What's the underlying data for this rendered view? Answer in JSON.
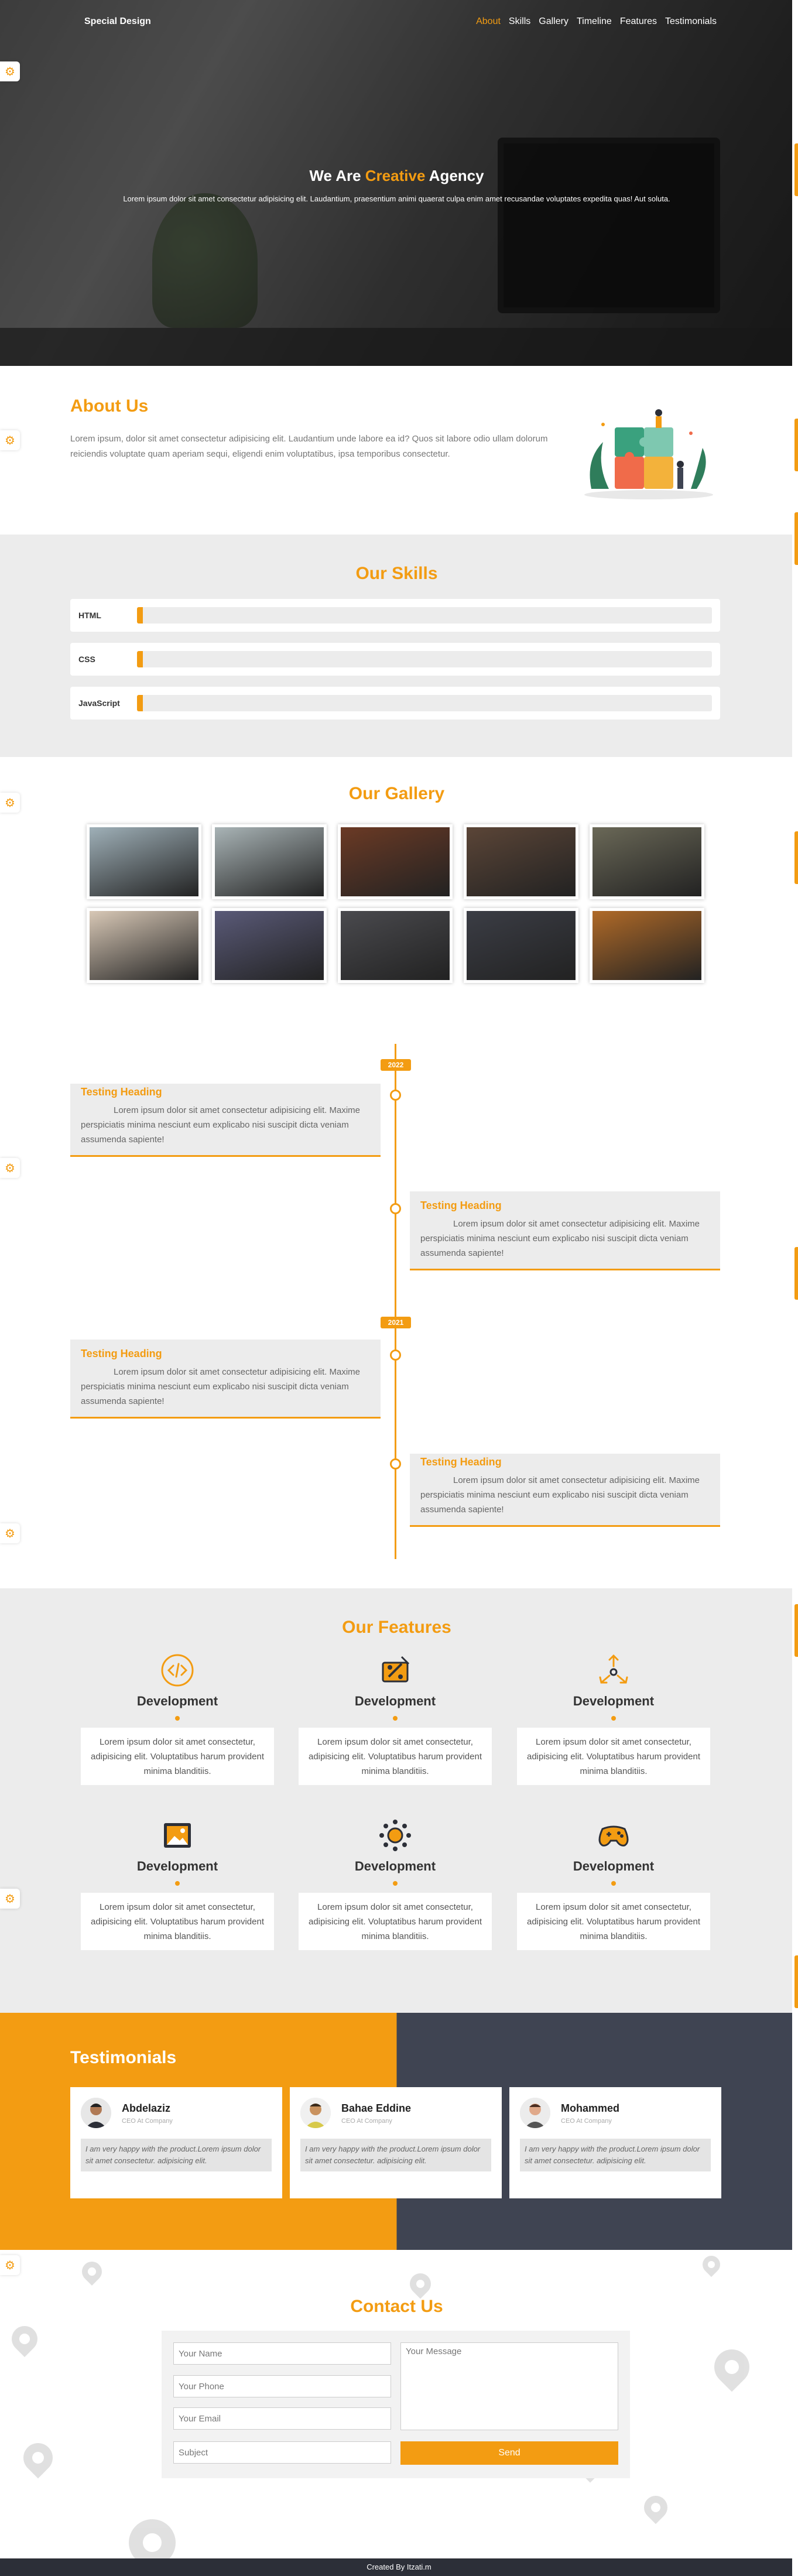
{
  "nav": {
    "logo": "Special Design",
    "links": [
      "About",
      "Skills",
      "Gallery",
      "Timeline",
      "Features",
      "Testimonials"
    ]
  },
  "hero": {
    "title_before": "We Are ",
    "title_accent": "Creative",
    "title_after": " Agency",
    "text": "Lorem ipsum dolor sit amet consectetur adipisicing elit. Laudantium, praesentium animi quaerat culpa enim amet recusandae voluptates expedita quas! Aut soluta."
  },
  "about": {
    "title": "About Us",
    "text": "Lorem ipsum, dolor sit amet consectetur adipisicing elit. Laudantium unde labore ea id? Quos sit labore odio ullam dolorum reiciendis voluptate quam aperiam sequi, eligendi enim voluptatibus, ipsa temporibus consectetur."
  },
  "skills": {
    "title": "Our Skills",
    "items": [
      {
        "name": "HTML",
        "progress": 1
      },
      {
        "name": "CSS",
        "progress": 1
      },
      {
        "name": "JavaScript",
        "progress": 1
      }
    ]
  },
  "gallery": {
    "title": "Our Gallery",
    "images": [
      {
        "alt": "woman-reading",
        "color": "#9fb0b8"
      },
      {
        "alt": "misty-forest",
        "color": "#a9b4b6"
      },
      {
        "alt": "mountain-sunset",
        "color": "#6b3a25"
      },
      {
        "alt": "team-meeting",
        "color": "#5b4537"
      },
      {
        "alt": "office-people",
        "color": "#6a6857"
      },
      {
        "alt": "man-laptop",
        "color": "#d8c8b6"
      },
      {
        "alt": "pink-mountain",
        "color": "#5a5a78"
      },
      {
        "alt": "desk-setup",
        "color": "#4a4a4e"
      },
      {
        "alt": "bookshelf",
        "color": "#3b3d45"
      },
      {
        "alt": "city-sunset",
        "color": "#b06a28"
      }
    ]
  },
  "timeline": {
    "years": [
      "2022",
      "2021"
    ],
    "items": [
      {
        "heading": "Testing Heading",
        "text": "Lorem ipsum dolor sit amet consectetur adipisicing elit. Maxime perspiciatis minima nesciunt eum explicabo nisi suscipit dicta veniam assumenda sapiente!"
      },
      {
        "heading": "Testing Heading",
        "text": "Lorem ipsum dolor sit amet consectetur adipisicing elit. Maxime perspiciatis minima nesciunt eum explicabo nisi suscipit dicta veniam assumenda sapiente!"
      },
      {
        "heading": "Testing Heading",
        "text": "Lorem ipsum dolor sit amet consectetur adipisicing elit. Maxime perspiciatis minima nesciunt eum explicabo nisi suscipit dicta veniam assumenda sapiente!"
      },
      {
        "heading": "Testing Heading",
        "text": "Lorem ipsum dolor sit amet consectetur adipisicing elit. Maxime perspiciatis minima nesciunt eum explicabo nisi suscipit dicta veniam assumenda sapiente!"
      }
    ]
  },
  "features": {
    "title": "Our Features",
    "items": [
      {
        "icon": "code-icon",
        "title": "Development",
        "text": "Lorem ipsum dolor sit amet consectetur, adipisicing elit. Voluptatibus harum provident minima blanditiis."
      },
      {
        "icon": "design-tools-icon",
        "title": "Development",
        "text": "Lorem ipsum dolor sit amet consectetur, adipisicing elit. Voluptatibus harum provident minima blanditiis."
      },
      {
        "icon": "network-icon",
        "title": "Development",
        "text": "Lorem ipsum dolor sit amet consectetur, adipisicing elit. Voluptatibus harum provident minima blanditiis."
      },
      {
        "icon": "image-icon",
        "title": "Development",
        "text": "Lorem ipsum dolor sit amet consectetur, adipisicing elit. Voluptatibus harum provident minima blanditiis."
      },
      {
        "icon": "settings-icon",
        "title": "Development",
        "text": "Lorem ipsum dolor sit amet consectetur, adipisicing elit. Voluptatibus harum provident minima blanditiis."
      },
      {
        "icon": "gamepad-icon",
        "title": "Development",
        "text": "Lorem ipsum dolor sit amet consectetur, adipisicing elit. Voluptatibus harum provident minima blanditiis."
      }
    ]
  },
  "testimonials": {
    "title": "Testimonials",
    "items": [
      {
        "name": "Abdelaziz",
        "role": "CEO At Company",
        "quote": "I am very happy with the product.Lorem ipsum dolor sit amet consectetur. adipisicing elit."
      },
      {
        "name": "Bahae Eddine",
        "role": "CEO At Company",
        "quote": "I am very happy with the product.Lorem ipsum dolor sit amet consectetur. adipisicing elit."
      },
      {
        "name": "Mohammed",
        "role": "CEO At Company",
        "quote": "I am very happy with the product.Lorem ipsum dolor sit amet consectetur. adipisicing elit."
      }
    ]
  },
  "contact": {
    "title": "Contact Us",
    "name_placeholder": "Your Name",
    "phone_placeholder": "Your Phone",
    "email_placeholder": "Your Email",
    "subject_placeholder": "Subject",
    "message_placeholder": "Your Message",
    "send_label": "Send"
  },
  "footer": {
    "text": "Created By Itzati.m"
  },
  "colors": {
    "accent": "#f39c12",
    "dark": "#3f4452",
    "light_bg": "#ececec"
  }
}
